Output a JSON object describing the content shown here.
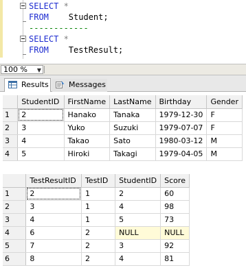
{
  "editor": {
    "lines": [
      {
        "kw": "SELECT",
        "rest": " *",
        "rest_type": "op"
      },
      {
        "kw": "FROM",
        "rest": "    Student;",
        "rest_type": "tx"
      },
      {
        "kw": "",
        "rest": "------------",
        "rest_type": "cm"
      },
      {
        "kw": "SELECT",
        "rest": " *",
        "rest_type": "op"
      },
      {
        "kw": "FROM",
        "rest": "    TestResult;",
        "rest_type": "tx"
      }
    ]
  },
  "zoom": {
    "value": "100 %"
  },
  "tabs": [
    {
      "label": "Results",
      "icon": "grid-icon"
    },
    {
      "label": "Messages",
      "icon": "messages-icon"
    }
  ],
  "grid1": {
    "columns": [
      "StudentID",
      "FirstName",
      "LastName",
      "Birthday",
      "Gender"
    ],
    "rows": [
      {
        "n": "1",
        "cells": [
          "2",
          "Hanako",
          "Tanaka",
          "1979-12-30",
          "F"
        ]
      },
      {
        "n": "2",
        "cells": [
          "3",
          "Yuko",
          "Suzuki",
          "1979-07-07",
          "F"
        ]
      },
      {
        "n": "3",
        "cells": [
          "4",
          "Takao",
          "Sato",
          "1980-03-12",
          "M"
        ]
      },
      {
        "n": "4",
        "cells": [
          "5",
          "Hiroki",
          "Takagi",
          "1979-04-05",
          "M"
        ]
      }
    ]
  },
  "grid2": {
    "columns": [
      "TestResultID",
      "TestID",
      "StudentID",
      "Score"
    ],
    "rows": [
      {
        "n": "1",
        "cells": [
          "2",
          "1",
          "2",
          "60"
        ]
      },
      {
        "n": "2",
        "cells": [
          "3",
          "1",
          "4",
          "98"
        ]
      },
      {
        "n": "3",
        "cells": [
          "4",
          "1",
          "5",
          "73"
        ]
      },
      {
        "n": "4",
        "cells": [
          "6",
          "2",
          "NULL",
          "NULL"
        ]
      },
      {
        "n": "5",
        "cells": [
          "7",
          "2",
          "3",
          "92"
        ]
      },
      {
        "n": "6",
        "cells": [
          "8",
          "2",
          "4",
          "81"
        ]
      }
    ]
  }
}
